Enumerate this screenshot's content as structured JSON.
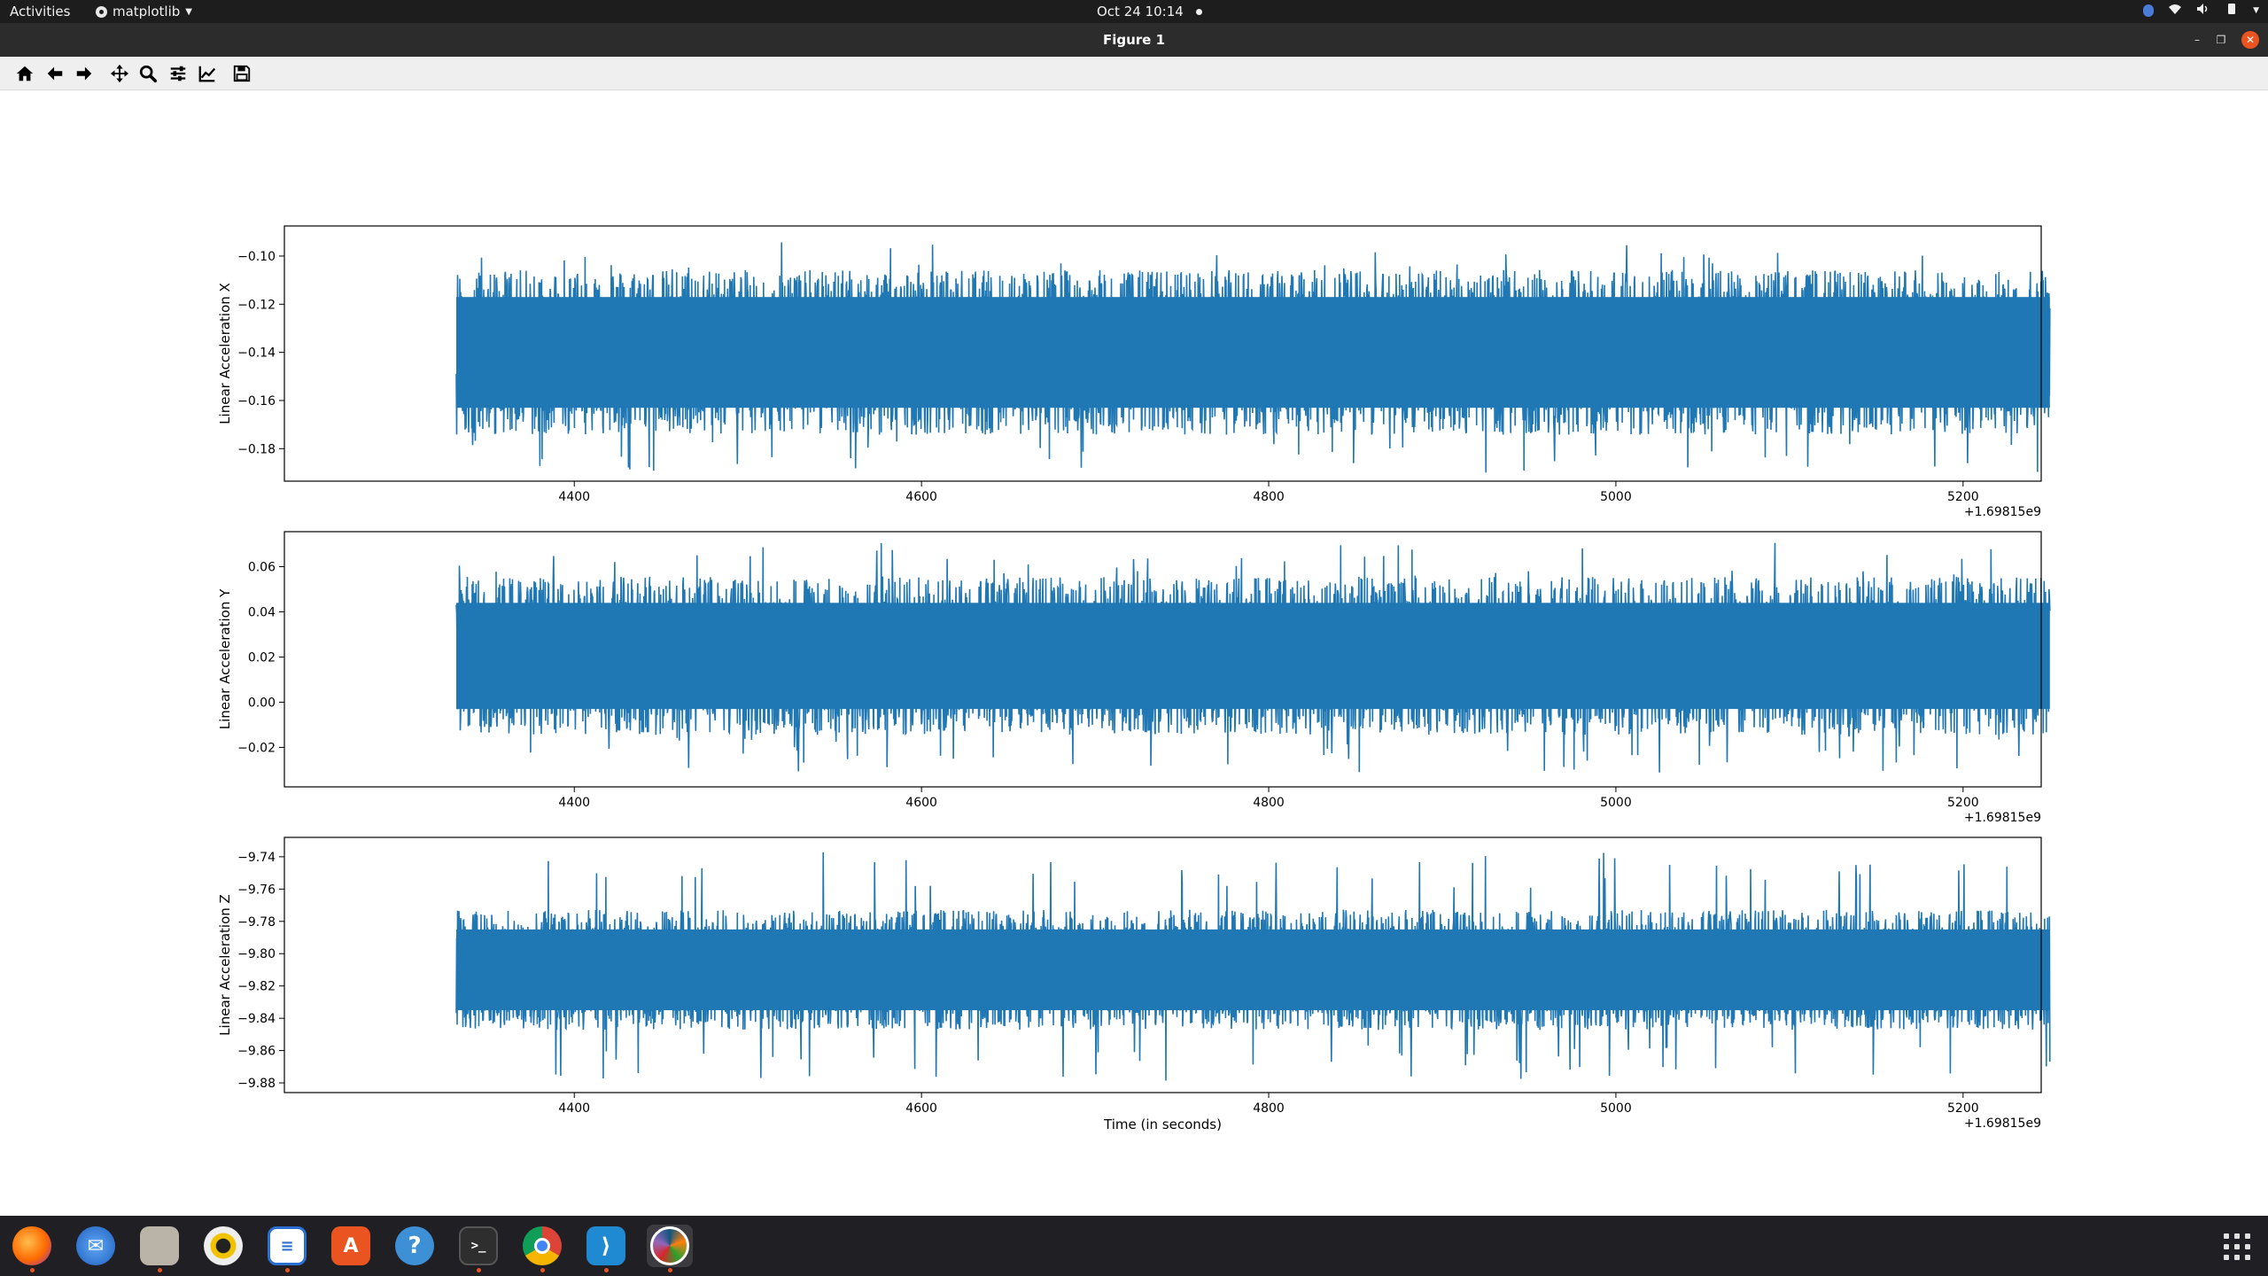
{
  "topbar": {
    "activities": "Activities",
    "app_name": "matplotlib",
    "clock": "Oct 24  10:14"
  },
  "window": {
    "title": "Figure 1"
  },
  "toolbar": {
    "buttons": [
      "home-icon",
      "back-arrow-icon",
      "forward-arrow-icon",
      "pan-move-icon",
      "zoom-magnifier-icon",
      "configure-subplots-icon",
      "edit-axis-icon",
      "save-floppy-icon"
    ]
  },
  "dock": {
    "apps": [
      "firefox-icon",
      "thunderbird-icon",
      "files-icon",
      "rhythmbox-icon",
      "writer-icon",
      "app-center-icon",
      "help-icon",
      "terminal-icon",
      "chrome-icon",
      "vscode-icon",
      "matplotlib-icon"
    ],
    "colors": {
      "accent": "#e95420"
    }
  },
  "chart_data": [
    {
      "type": "line",
      "ylabel": "Linear Acceleration X",
      "xlabel": "",
      "x_offset_label": "+1.69815e9",
      "x_range": [
        4332,
        5250
      ],
      "xlim": [
        4233,
        5245
      ],
      "ylim": [
        -0.1935,
        -0.0875
      ],
      "yticks": [
        -0.1,
        -0.12,
        -0.14,
        -0.16,
        -0.18
      ],
      "ytick_labels": [
        "−0.10",
        "−0.12",
        "−0.14",
        "−0.16",
        "−0.18"
      ],
      "xticks": [
        4400,
        4600,
        4800,
        5000,
        5200
      ],
      "xtick_labels": [
        "4400",
        "4600",
        "4800",
        "5000",
        "5200"
      ],
      "mean": -0.14,
      "band_low": -0.163,
      "band_high": -0.117,
      "min": -0.19,
      "max": -0.094,
      "color": "#1f77b4"
    },
    {
      "type": "line",
      "ylabel": "Linear Acceleration Y",
      "xlabel": "",
      "x_offset_label": "+1.69815e9",
      "x_range": [
        4332,
        5250
      ],
      "xlim": [
        4233,
        5245
      ],
      "ylim": [
        -0.0375,
        0.0755
      ],
      "yticks": [
        0.06,
        0.04,
        0.02,
        0.0,
        -0.02
      ],
      "ytick_labels": [
        "0.06",
        "0.04",
        "0.02",
        "0.00",
        "−0.02"
      ],
      "xticks": [
        4400,
        4600,
        4800,
        5000,
        5200
      ],
      "xtick_labels": [
        "4400",
        "4600",
        "4800",
        "5000",
        "5200"
      ],
      "mean": 0.02,
      "band_low": -0.003,
      "band_high": 0.044,
      "min": -0.032,
      "max": 0.071,
      "color": "#1f77b4"
    },
    {
      "type": "line",
      "ylabel": "Linear Acceleration Z",
      "xlabel": "Time (in seconds)",
      "x_offset_label": "+1.69815e9",
      "x_range": [
        4332,
        5250
      ],
      "xlim": [
        4233,
        5245
      ],
      "ylim": [
        -9.886,
        -9.728
      ],
      "yticks": [
        -9.74,
        -9.76,
        -9.78,
        -9.8,
        -9.82,
        -9.84,
        -9.86,
        -9.88
      ],
      "ytick_labels": [
        "−9.74",
        "−9.76",
        "−9.78",
        "−9.80",
        "−9.82",
        "−9.84",
        "−9.86",
        "−9.88"
      ],
      "xticks": [
        4400,
        4600,
        4800,
        5000,
        5200
      ],
      "xtick_labels": [
        "4400",
        "4600",
        "4800",
        "5000",
        "5200"
      ],
      "mean": -9.81,
      "band_low": -9.835,
      "band_high": -9.785,
      "min": -9.879,
      "max": -9.737,
      "color": "#1f77b4"
    }
  ]
}
